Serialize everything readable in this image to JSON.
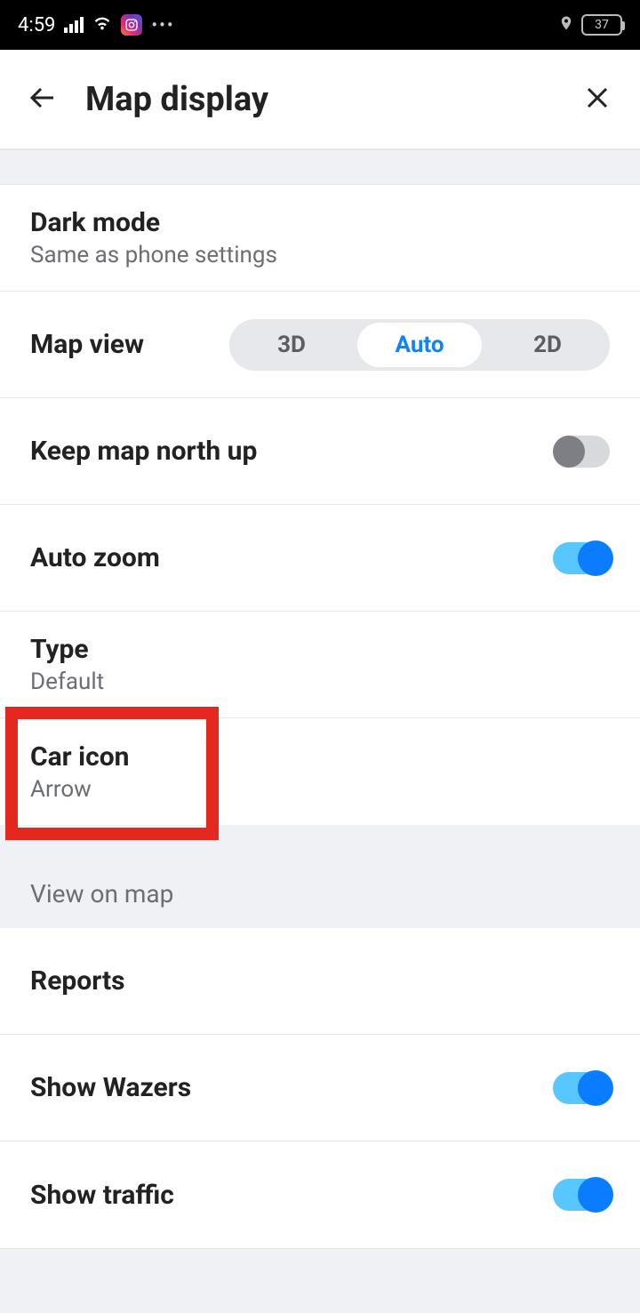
{
  "status": {
    "time": "4:59",
    "battery": "37"
  },
  "header": {
    "title": "Map display"
  },
  "settings": {
    "darkMode": {
      "title": "Dark mode",
      "sub": "Same as phone settings"
    },
    "mapView": {
      "title": "Map view",
      "options": [
        "3D",
        "Auto",
        "2D"
      ],
      "selected": "Auto"
    },
    "northUp": {
      "title": "Keep map north up",
      "on": false
    },
    "autoZoom": {
      "title": "Auto zoom",
      "on": true
    },
    "type": {
      "title": "Type",
      "sub": "Default"
    },
    "carIcon": {
      "title": "Car icon",
      "sub": "Arrow"
    }
  },
  "sectionHeader": {
    "viewOnMap": "View on map"
  },
  "mapItems": {
    "reports": {
      "title": "Reports"
    },
    "showWazers": {
      "title": "Show Wazers",
      "on": true
    },
    "showTraffic": {
      "title": "Show traffic",
      "on": true
    }
  }
}
